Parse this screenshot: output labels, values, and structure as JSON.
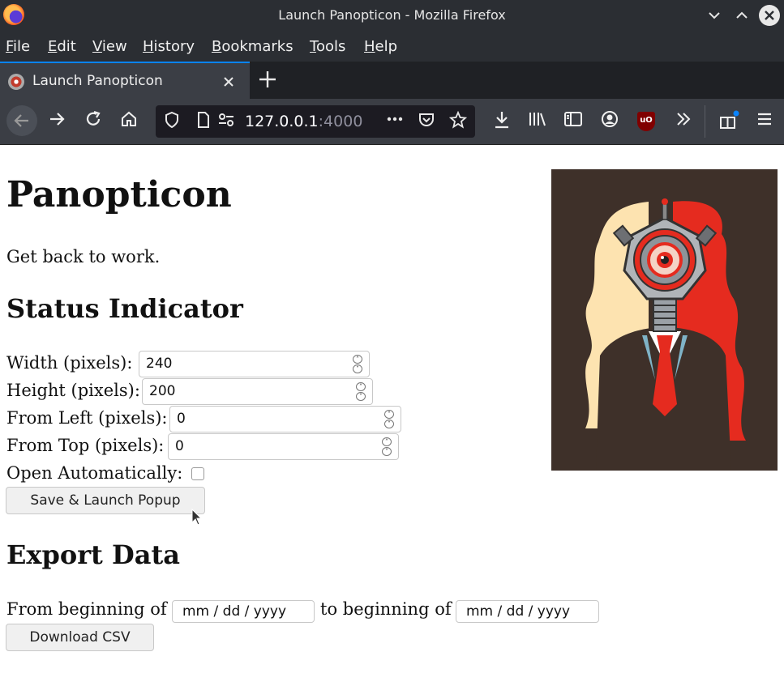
{
  "window": {
    "title": "Launch Panopticon - Mozilla Firefox",
    "minimize_icon": "chevron-down-icon",
    "maximize_icon": "chevron-up-icon",
    "close_icon": "close-icon"
  },
  "menubar": {
    "items": [
      "File",
      "Edit",
      "View",
      "History",
      "Bookmarks",
      "Tools",
      "Help"
    ]
  },
  "tabs": [
    {
      "label": "Launch Panopticon",
      "active": true
    }
  ],
  "navbar": {
    "url_host": "127.0.0.1",
    "url_port": ":4000"
  },
  "page": {
    "title": "Panopticon",
    "subtitle": "Get back to work.",
    "status_section": {
      "heading": "Status Indicator",
      "fields": [
        {
          "label": "Width (pixels):",
          "value": "240"
        },
        {
          "label": "Height (pixels):",
          "value": "200"
        },
        {
          "label": "From Left (pixels):",
          "value": "0"
        },
        {
          "label": "From Top (pixels):",
          "value": "0"
        }
      ],
      "open_auto_label": "Open Automatically:",
      "open_auto_checked": false,
      "save_button": "Save & Launch Popup"
    },
    "export_section": {
      "heading": "Export Data",
      "from_label": "From beginning of",
      "to_label": "to beginning of",
      "from_placeholder": "mm / dd / yyyy",
      "to_placeholder": "mm / dd / yyyy",
      "download_button": "Download CSV"
    }
  },
  "colors": {
    "accent": "#0a84ff",
    "poster_bg": "#3e3029",
    "poster_red": "#e52b1f",
    "poster_cream": "#fde3b0"
  }
}
